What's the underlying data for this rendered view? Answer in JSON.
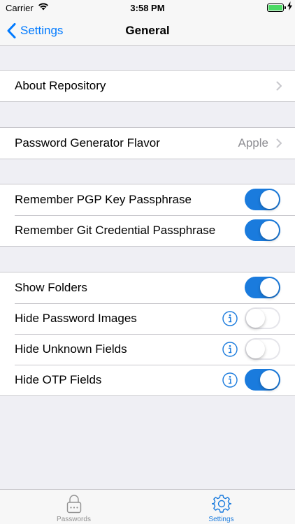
{
  "status_bar": {
    "carrier": "Carrier",
    "time": "3:58 PM",
    "battery_level": 1.0,
    "charging": true
  },
  "nav": {
    "back_label": "Settings",
    "title": "General"
  },
  "groups": [
    {
      "rows": [
        {
          "label": "About Repository",
          "accessory": "chevron"
        }
      ]
    },
    {
      "rows": [
        {
          "label": "Password Generator Flavor",
          "detail": "Apple",
          "accessory": "chevron"
        }
      ]
    },
    {
      "rows": [
        {
          "label": "Remember PGP Key Passphrase",
          "toggle": true
        },
        {
          "label": "Remember Git Credential Passphrase",
          "toggle": true
        }
      ]
    },
    {
      "rows": [
        {
          "label": "Show Folders",
          "toggle": true,
          "info": false
        },
        {
          "label": "Hide Password Images",
          "toggle": false,
          "info": true
        },
        {
          "label": "Hide Unknown Fields",
          "toggle": false,
          "info": true
        },
        {
          "label": "Hide OTP Fields",
          "toggle": true,
          "info": true
        }
      ]
    }
  ],
  "tab_bar": {
    "tabs": [
      {
        "label": "Passwords",
        "icon": "lock-icon",
        "active": false
      },
      {
        "label": "Settings",
        "icon": "gear-icon",
        "active": true
      }
    ]
  },
  "colors": {
    "accent": "#1a7bdd",
    "back_link": "#007aff",
    "background": "#efeff4",
    "switch_on": "#1a7bdd"
  }
}
